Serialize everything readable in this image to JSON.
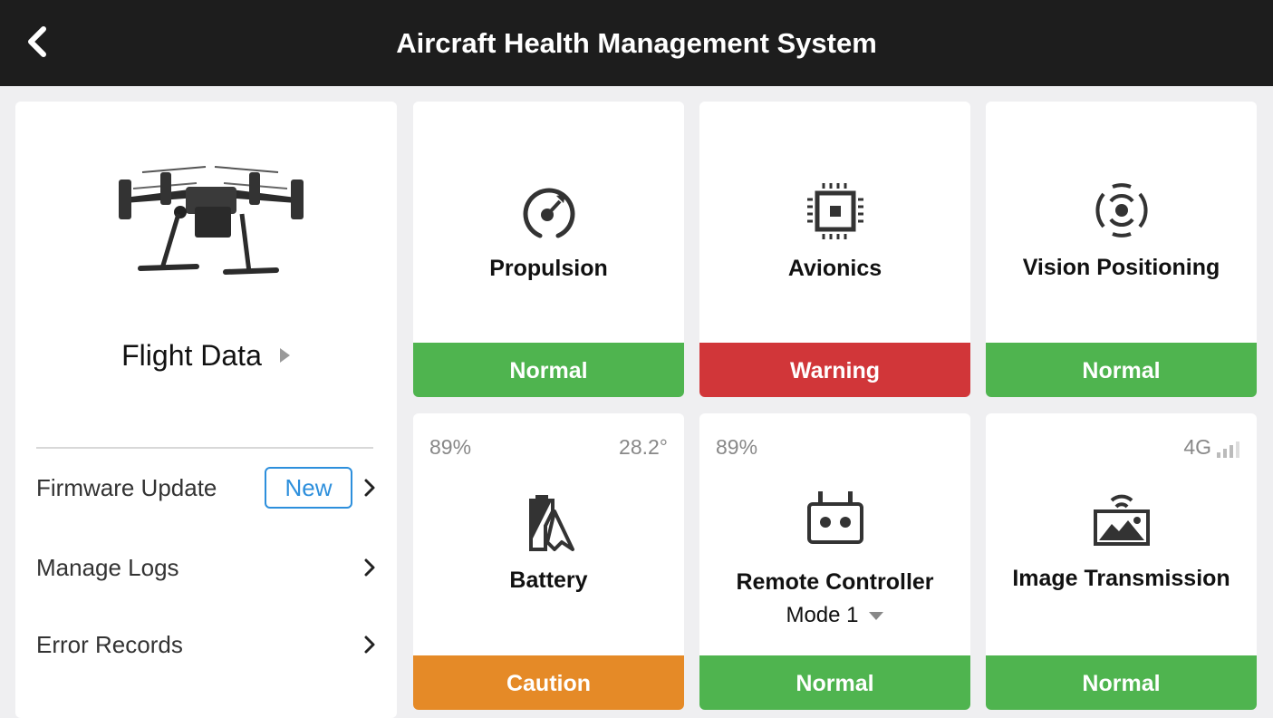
{
  "header": {
    "title": "Aircraft Health Management System",
    "back_icon": "chevron-left-icon"
  },
  "sidebar": {
    "flight_data_label": "Flight Data",
    "menu": [
      {
        "label": "Firmware Update",
        "badge": "New"
      },
      {
        "label": "Manage Logs"
      },
      {
        "label": "Error Records"
      }
    ]
  },
  "colors": {
    "normal": "#4fb44f",
    "warning": "#d13639",
    "caution": "#e58a27",
    "header": "#1d1d1d",
    "badge": "#2d8fdc"
  },
  "modules": [
    {
      "name": "Propulsion",
      "status": "Normal",
      "icon": "propulsion-icon"
    },
    {
      "name": "Avionics",
      "status": "Warning",
      "icon": "avionics-chip-icon"
    },
    {
      "name": "Vision Positioning",
      "status": "Normal",
      "icon": "vision-positioning-icon"
    },
    {
      "name": "Battery",
      "status": "Caution",
      "icon": "battery-icon",
      "level": "89%",
      "temperature": "28.2°"
    },
    {
      "name": "Remote Controller",
      "status": "Normal",
      "icon": "remote-controller-icon",
      "level": "89%",
      "mode": "Mode 1"
    },
    {
      "name": "Image Transmission",
      "status": "Normal",
      "icon": "image-transmission-icon",
      "network": "4G"
    }
  ]
}
